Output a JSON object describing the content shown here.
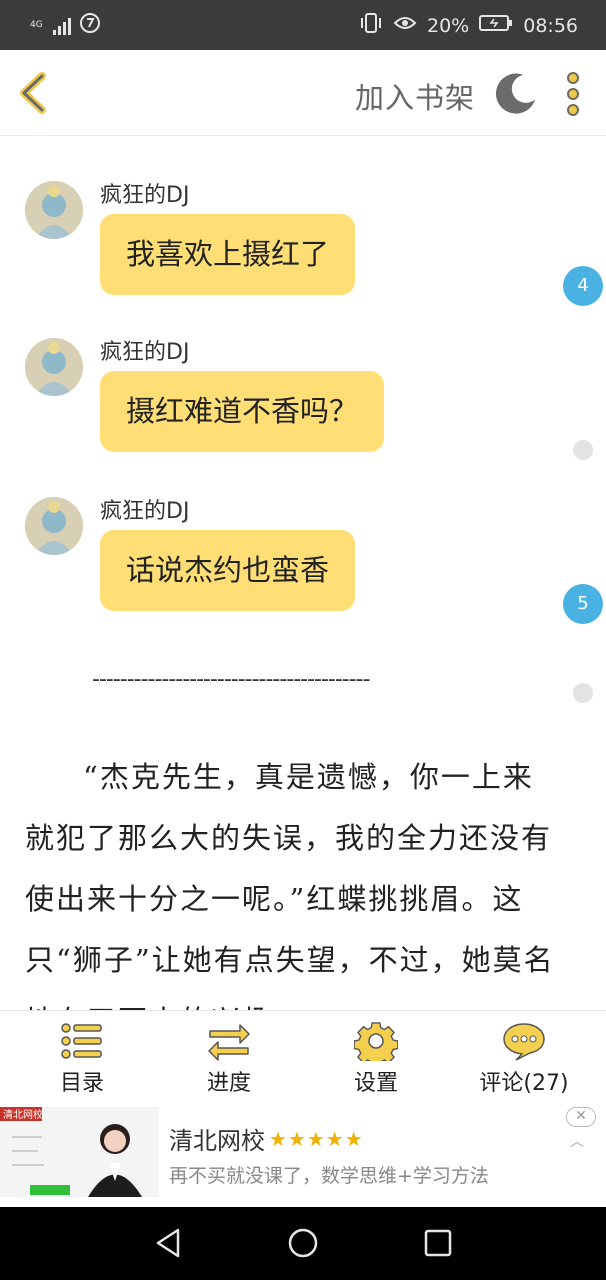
{
  "status_bar": {
    "network": "4G",
    "battery": "20%",
    "time": "08:56"
  },
  "header": {
    "add_to_shelf": "加入书架",
    "night_mode_icon": "moon-icon",
    "more_icon": "more-vertical-icon"
  },
  "chat": [
    {
      "author": "疯狂的DJ",
      "text": "我喜欢上摄红了"
    },
    {
      "author": "疯狂的DJ",
      "text": "摄红难道不香吗？"
    },
    {
      "author": "疯狂的DJ",
      "text": "话说杰约也蛮香"
    }
  ],
  "comment_badges": [
    "4",
    "5"
  ],
  "divider": "----------------------------------------",
  "paragraph": "“杰克先生，真是遗憾，你一上来就犯了那么大的失误，我的全力还没有使出来十分之一呢。”红蝶挑挑眉。这只“狮子”让她有点失望，不过，她莫名地有了更大的兴趣。",
  "toolbar": {
    "catalog": "目录",
    "progress": "进度",
    "settings": "设置",
    "comments": "评论(27)"
  },
  "ad": {
    "image_label": "清北网校",
    "title": "清北网校",
    "stars": "★★★★★",
    "description": "再不买就没课了，数学思维+学习方法"
  },
  "colors": {
    "accent": "#fede75",
    "badge": "#49b2e3",
    "status_bar": "#3b3b3b"
  }
}
